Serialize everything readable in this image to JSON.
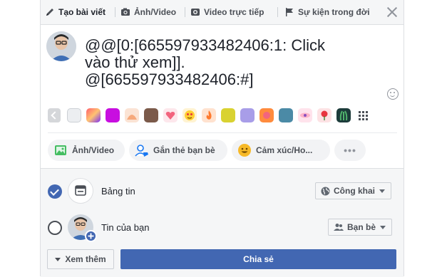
{
  "tabs": [
    {
      "label": "Tạo bài viết",
      "icon": "pencil-icon"
    },
    {
      "label": "Ảnh/Video",
      "icon": "camera-icon"
    },
    {
      "label": "Video trực tiếp",
      "icon": "live-video-icon"
    },
    {
      "label": "Sự kiện trong đời",
      "icon": "flag-icon"
    }
  ],
  "composer": {
    "text": "@@[0:[665597933482406:1: Click\nvào thử xem]].\n@[665597933482406:#]"
  },
  "backgrounds": {
    "swatches": [
      "#eceef1",
      "#f05f80",
      "#c80ee0",
      "#f6a97c",
      "#7b5a4a",
      "#f2647e",
      "#ffcf33",
      "#ff7a2e",
      "#d9d231",
      "#a89de8",
      "#ff8b3d",
      "#4b8aa6",
      "#ffb3c9",
      "#e8353f",
      "#1c3b3a"
    ]
  },
  "actions": [
    {
      "label": "Ảnh/Video",
      "icon": "photo-icon"
    },
    {
      "label": "Gắn thẻ bạn bè",
      "icon": "tag-friends-icon"
    },
    {
      "label": "Cảm xúc/Ho...",
      "icon": "feeling-icon"
    },
    {
      "label": "•••",
      "icon": "more-icon"
    }
  ],
  "destinations": [
    {
      "label": "Bảng tin",
      "checked": true,
      "privacy": "Công khai",
      "privacy_icon": "globe-icon"
    },
    {
      "label": "Tin của bạn",
      "checked": false,
      "privacy": "Bạn bè",
      "privacy_icon": "friends-icon"
    }
  ],
  "footer": {
    "more_label": "Xem thêm",
    "share_label": "Chia sẻ"
  },
  "colors": {
    "primary": "#4267b2",
    "text": "#1d2129",
    "muted": "#4b4f56"
  }
}
